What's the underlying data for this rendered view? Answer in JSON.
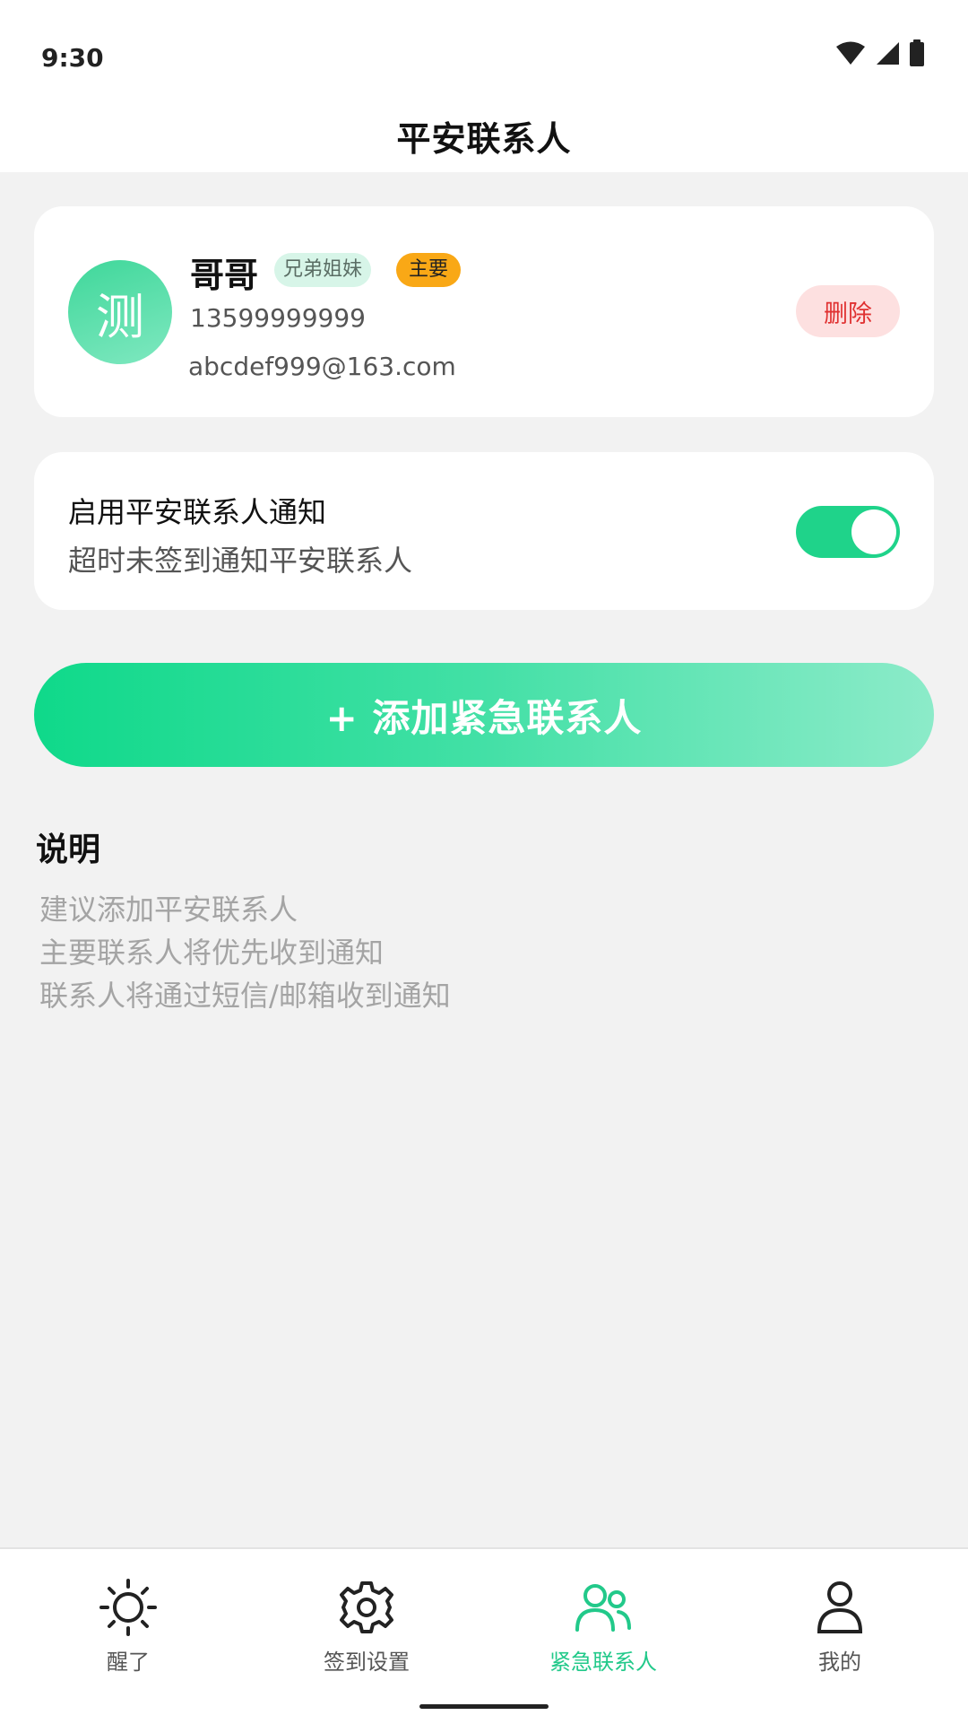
{
  "status_bar": {
    "time": "9:30"
  },
  "header": {
    "title": "平安联系人"
  },
  "contact": {
    "avatar_text": "测",
    "name": "哥哥",
    "relation_tag": "兄弟姐妹",
    "primary_tag": "主要",
    "phone": "13599999999",
    "email": "abcdef999@163.com",
    "delete_label": "删除"
  },
  "notification_toggle": {
    "title": "启用平安联系人通知",
    "subtitle": "超时未签到通知平安联系人",
    "enabled": true
  },
  "add_button": {
    "label": "+ 添加紧急联系人"
  },
  "notes": {
    "heading": "说明",
    "lines": [
      "建议添加平安联系人",
      "主要联系人将优先收到通知",
      "联系人将通过短信/邮箱收到通知"
    ]
  },
  "tabbar": {
    "tabs": [
      {
        "label": "醒了",
        "icon": "sun-icon",
        "active": false
      },
      {
        "label": "签到设置",
        "icon": "gear-icon",
        "active": false
      },
      {
        "label": "紧急联系人",
        "icon": "contacts-icon",
        "active": true
      },
      {
        "label": "我的",
        "icon": "person-icon",
        "active": false
      }
    ]
  },
  "colors": {
    "accent": "#1fd38a",
    "primary_tag": "#f9a816",
    "delete": "#e03131",
    "background": "#f2f2f2"
  }
}
